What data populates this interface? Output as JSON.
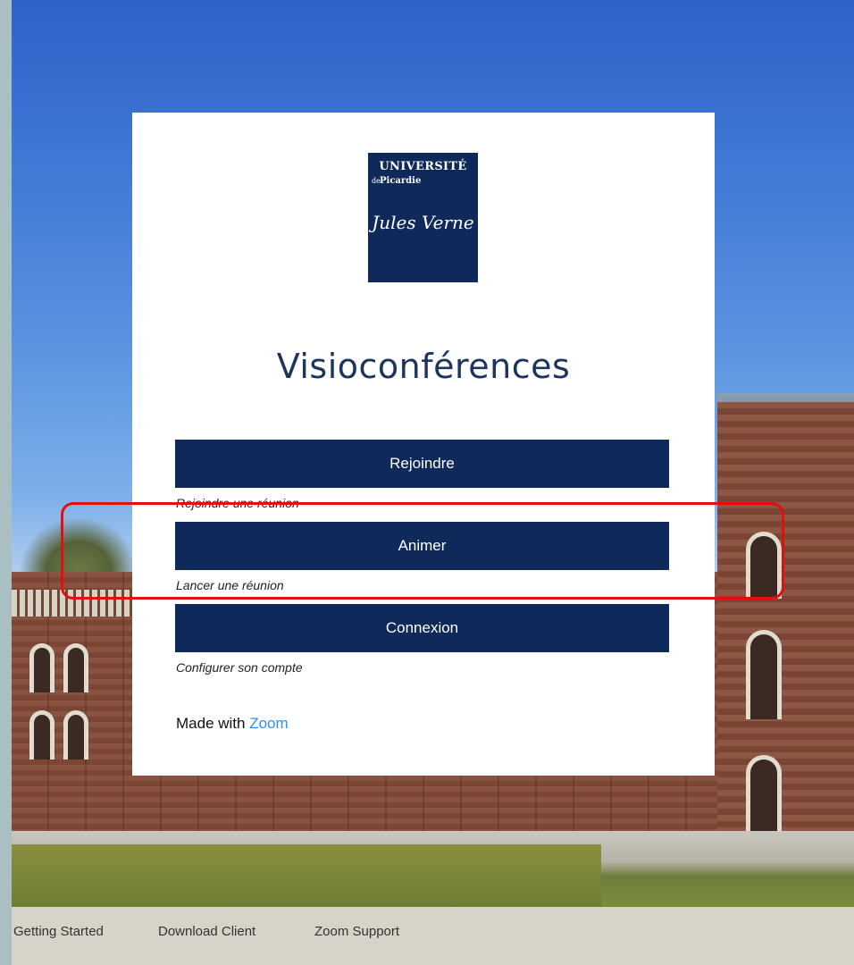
{
  "logo": {
    "university": "UNIVERSITÉ",
    "de": "de",
    "picardie": "Picardie",
    "signature": "Jules Verne"
  },
  "title": "Visioconférences",
  "buttons": [
    {
      "label": "Rejoindre",
      "caption": "Rejoindre une réunion"
    },
    {
      "label": "Animer",
      "caption": "Lancer une réunion"
    },
    {
      "label": "Connexion",
      "caption": "Configurer son compte"
    }
  ],
  "made_with": {
    "prefix": "Made with",
    "link": "Zoom"
  },
  "footer": {
    "links": [
      "Getting Started",
      "Download Client",
      "Zoom Support"
    ]
  },
  "colors": {
    "brand_navy": "#0f2a5a",
    "title": "#1c355e",
    "zoom_blue": "#2d8cff",
    "highlight_red": "#e01010"
  }
}
